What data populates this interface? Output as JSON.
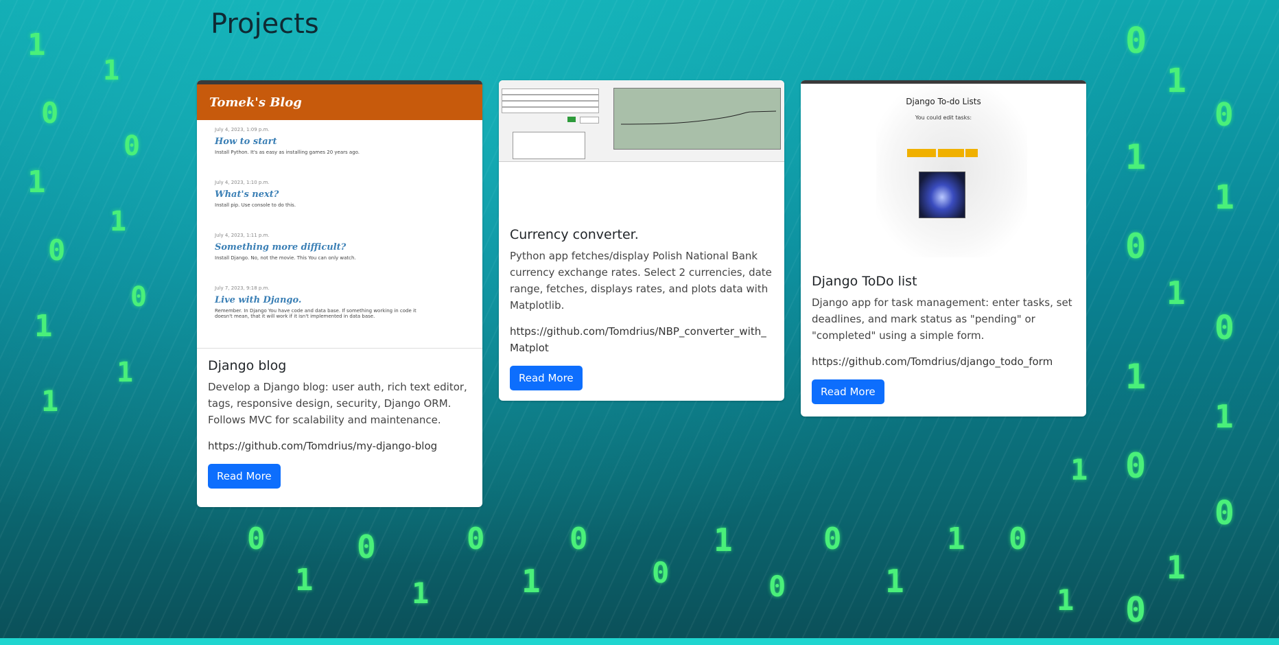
{
  "page": {
    "title": "Projects"
  },
  "projects": [
    {
      "thumbnail": {
        "brand": "Tomek's Blog",
        "posts": [
          {
            "date": "July 4, 2023, 1:09 p.m.",
            "title": "How to start",
            "excerpt": "Install Python. It's as easy as installing games 20 years ago."
          },
          {
            "date": "July 4, 2023, 1:10 p.m.",
            "title": "What's next?",
            "excerpt": "Install pip. Use console to do this."
          },
          {
            "date": "July 4, 2023, 1:11 p.m.",
            "title": "Something more difficult?",
            "excerpt": "Install Django. No, not the movie. This You can only watch."
          },
          {
            "date": "July 7, 2023, 9:18 p.m.",
            "title": "Live with Django.",
            "excerpt": "Remember. In Django You have code and data base. If something working in code it doesn't mean, that it will work if it isn't implemented in data base."
          }
        ]
      },
      "title": "Django blog",
      "description": "Develop a Django blog: user auth, rich text editor, tags, responsive design, security, Django ORM. Follows MVC for scalability and maintenance.",
      "link": "https://github.com/Tomdrius/my-django-blog",
      "button": "Read More"
    },
    {
      "title": "Currency converter.",
      "description": "Python app fetches/display Polish National Bank currency exchange rates. Select 2 currencies, date range, fetches, displays rates, and plots data with Matplotlib.",
      "link": "https://github.com/Tomdrius/NBP_converter_with_Matplot",
      "button": "Read More"
    },
    {
      "thumbnail": {
        "heading": "Django To-do Lists",
        "subheading": "You could edit tasks:"
      },
      "title": "Django ToDo list",
      "description": "Django app for task management: enter tasks, set deadlines, and mark status as \"pending\" or \"completed\" using a simple form.",
      "link": "https://github.com/Tomdrius/django_todo_form",
      "button": "Read More"
    }
  ],
  "colors": {
    "accent": "#0d6efd",
    "blog_header": "#c75a0c",
    "matrix_digit": "#4af07a"
  }
}
